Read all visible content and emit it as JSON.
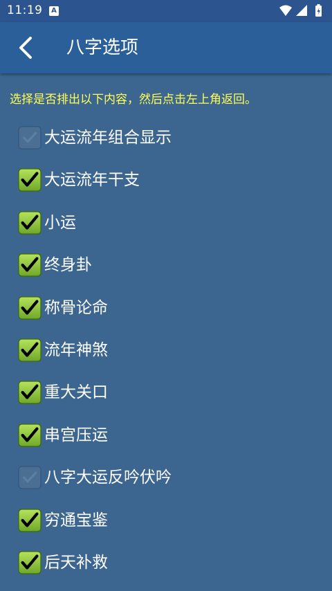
{
  "status_bar": {
    "time": "11:19",
    "notification_icon": "android-icon",
    "icons": [
      "wifi-icon",
      "signal-icon",
      "battery-icon"
    ]
  },
  "app_bar": {
    "title": "八字选项",
    "back_icon": "chevron-left-icon"
  },
  "instruction": "选择是否排出以下内容，然后点击左上角返回。",
  "options": [
    {
      "label": "大运流年组合显示",
      "checked": false
    },
    {
      "label": "大运流年干支",
      "checked": true
    },
    {
      "label": "小运",
      "checked": true
    },
    {
      "label": "终身卦",
      "checked": true
    },
    {
      "label": "称骨论命",
      "checked": true
    },
    {
      "label": "流年神煞",
      "checked": true
    },
    {
      "label": "重大关口",
      "checked": true
    },
    {
      "label": "串宫压运",
      "checked": true
    },
    {
      "label": "八字大运反吟伏吟",
      "checked": false
    },
    {
      "label": "穷通宝鉴",
      "checked": true
    },
    {
      "label": "后天补救",
      "checked": true
    }
  ],
  "colors": {
    "background": "#3c6690",
    "app_bar": "#2b5f9a",
    "status_bar": "#2c5590",
    "instruction_text": "#ffff55",
    "checkbox_checked": "#8cc63f"
  }
}
